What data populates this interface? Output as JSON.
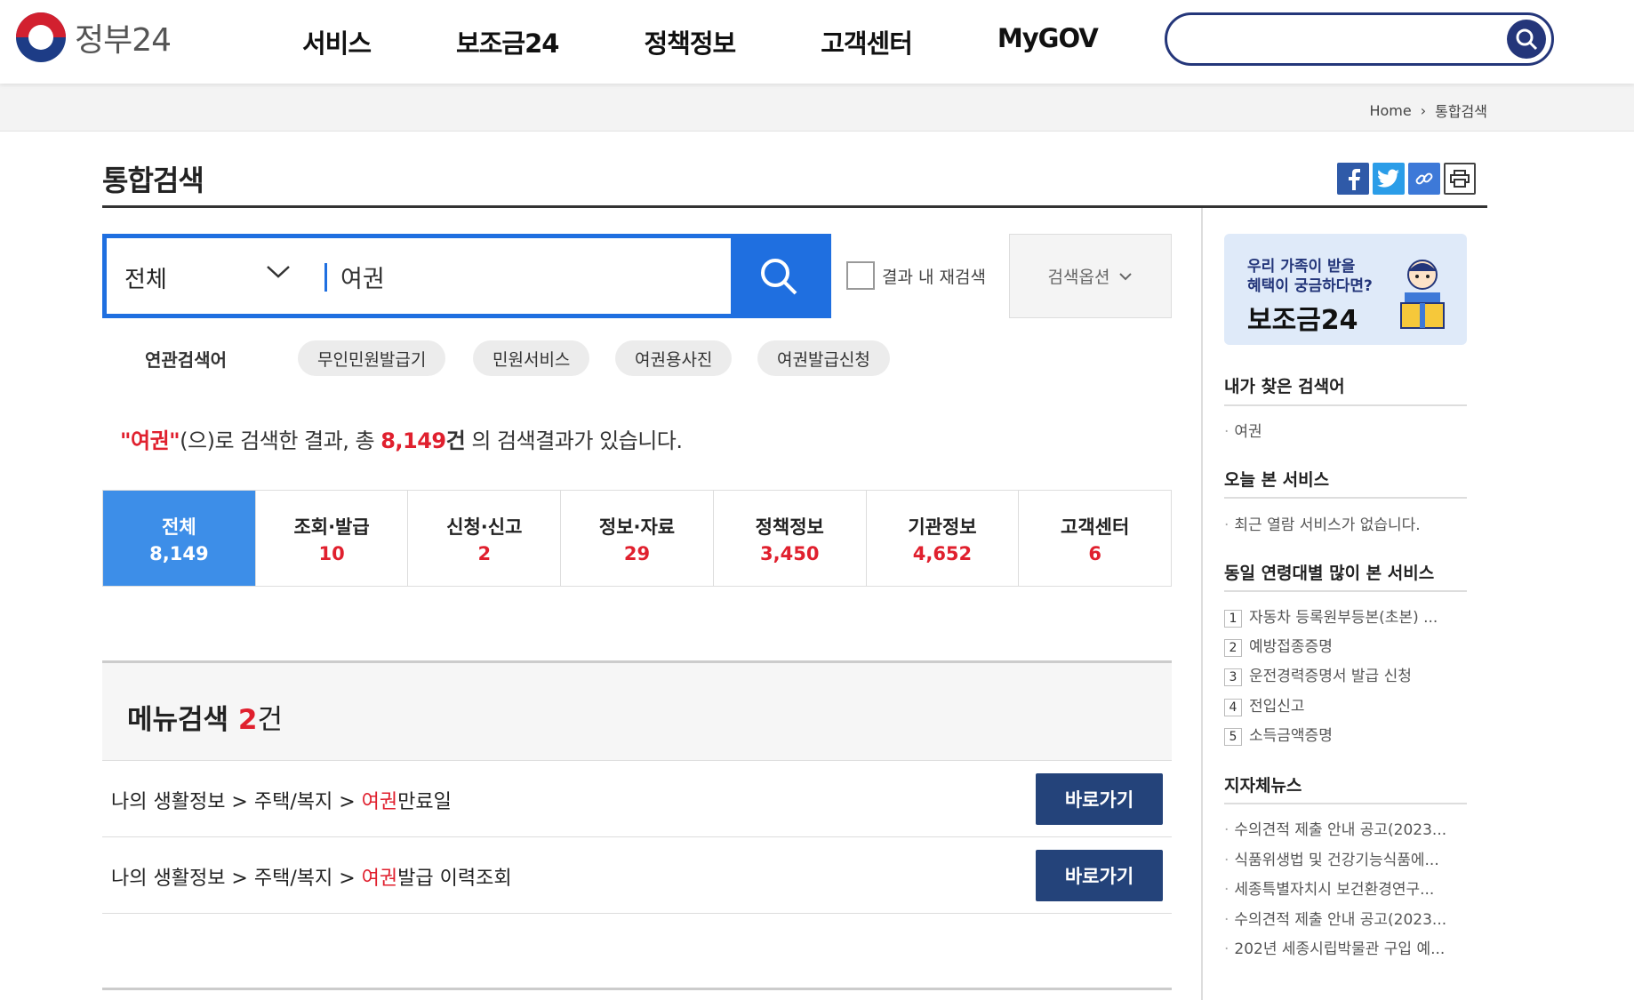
{
  "header": {
    "logo_text": "정부24",
    "nav": [
      "서비스",
      "보조금24",
      "정책정보",
      "고객센터",
      "MyGOV"
    ],
    "search_value": ""
  },
  "breadcrumb": {
    "home": "Home",
    "current": "통합검색"
  },
  "page_title": "통합검색",
  "search": {
    "scope": "전체",
    "query": "여권",
    "refine_label": "결과 내 재검색",
    "options_label": "검색옵션"
  },
  "related": {
    "label": "연관검색어",
    "tags": [
      "무인민원발급기",
      "민원서비스",
      "여권용사진",
      "여권발급신청"
    ]
  },
  "summary": {
    "keyword": "\"여권\"",
    "text1": "(으)로 검색한 결과, 총 ",
    "total": "8,149",
    "unit": "건",
    "text2": " 의 검색결과가 있습니다."
  },
  "tabs": [
    {
      "name": "전체",
      "count": "8,149",
      "active": true
    },
    {
      "name": "조회·발급",
      "count": "10"
    },
    {
      "name": "신청·신고",
      "count": "2"
    },
    {
      "name": "정보·자료",
      "count": "29"
    },
    {
      "name": "정책정보",
      "count": "3,450"
    },
    {
      "name": "기관정보",
      "count": "4,652"
    },
    {
      "name": "고객센터",
      "count": "6"
    }
  ],
  "menu_search": {
    "title": "메뉴검색",
    "count": "2",
    "unit": "건",
    "rows": [
      {
        "prefix": "나의 생활정보 > 주택/복지 > ",
        "highlight": "여권",
        "suffix": "만료일",
        "button": "바로가기"
      },
      {
        "prefix": "나의 생활정보 > 주택/복지 > ",
        "highlight": "여권",
        "suffix": "발급 이력조회",
        "button": "바로가기"
      }
    ]
  },
  "sidebar": {
    "banner": {
      "line1": "우리 가족이 받을",
      "line2": "혜택이 궁금하다면?",
      "big": "보조금24"
    },
    "my_keywords": {
      "title": "내가 찾은 검색어",
      "items": [
        "여권"
      ]
    },
    "today": {
      "title": "오늘 본 서비스",
      "items": [
        "최근 열람 서비스가 없습니다."
      ]
    },
    "popular": {
      "title": "동일 연령대별 많이 본 서비스",
      "items": [
        "자동차 등록원부등본(초본) ...",
        "예방접종증명",
        "운전경력증명서 발급 신청",
        "전입신고",
        "소득금액증명"
      ]
    },
    "news": {
      "title": "지자체뉴스",
      "items": [
        "수의견적 제출 안내 공고(2023...",
        "식품위생법 및 건강기능식품에...",
        "세종특별자치시 보건환경연구...",
        "수의견적 제출 안내 공고(2023...",
        "202년 세종시립박물관 구입 예..."
      ]
    }
  },
  "colors": {
    "primary": "#1f6fe0",
    "navy": "#24367a",
    "accent_red": "#e0202e",
    "tab_active": "#3d8ee8"
  }
}
